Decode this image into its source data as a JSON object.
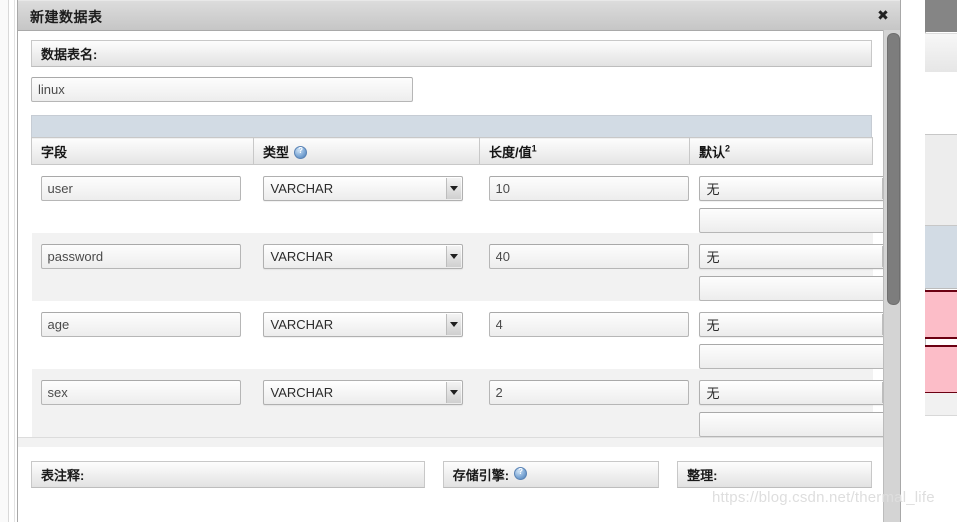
{
  "window": {
    "title": "新建数据表",
    "close_label": "✖"
  },
  "table_name_section": {
    "label": "数据表名:",
    "value": "linux",
    "placeholder": ""
  },
  "columns": {
    "field": "字段",
    "type": "类型",
    "type_info_icon": "info-icon",
    "length": "长度/值",
    "length_sup": "1",
    "default": "默认",
    "default_sup": "2"
  },
  "rows": [
    {
      "field": "user",
      "type": "VARCHAR",
      "length": "10",
      "default": "无",
      "default_value": ""
    },
    {
      "field": "password",
      "type": "VARCHAR",
      "length": "40",
      "default": "无",
      "default_value": ""
    },
    {
      "field": "age",
      "type": "VARCHAR",
      "length": "4",
      "default": "无",
      "default_value": ""
    },
    {
      "field": "sex",
      "type": "VARCHAR",
      "length": "2",
      "default": "无",
      "default_value": ""
    }
  ],
  "footer": {
    "comment_label": "表注释:",
    "engine_label": "存储引擎:",
    "engine_info_icon": "info-icon",
    "collation_label": "整理:"
  },
  "watermark": "https://blog.csdn.net/thermal_life",
  "colors": {
    "titlebar": "#c6c6c6",
    "strip_blue": "#d2dbe4",
    "row_even": "#f2f2f2",
    "scrollbar_thumb": "#7d7d7d",
    "bg_highlight_pink": "#fcbdc8",
    "bg_highlight_border": "#6b0012"
  }
}
